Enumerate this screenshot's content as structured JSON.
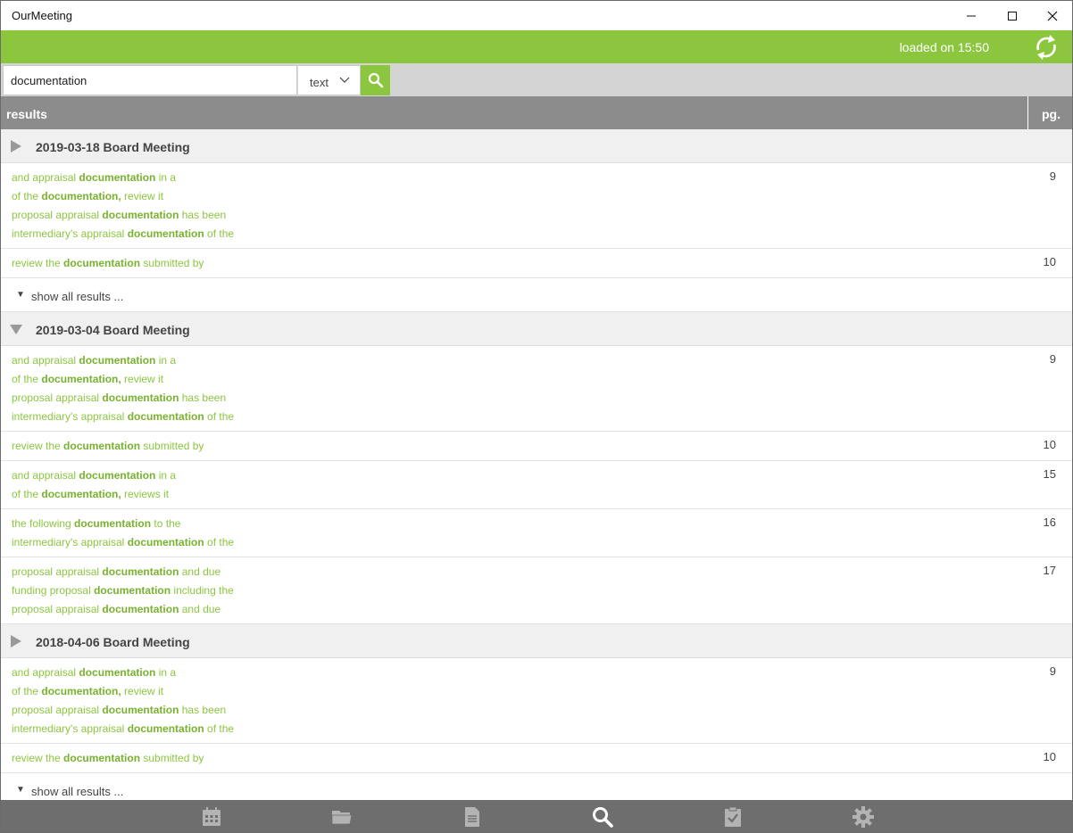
{
  "window": {
    "title": "OurMeeting"
  },
  "header": {
    "loaded_text": "loaded on 15:50"
  },
  "search": {
    "value": "documentation",
    "type_selected": "text"
  },
  "results_header": {
    "label": "results",
    "page_label": "pg."
  },
  "show_all_label": "show all results ...",
  "groups": [
    {
      "title": "2019-03-18 Board Meeting",
      "expanded": false,
      "hits": [
        {
          "page": "9",
          "lines": [
            {
              "pre": "and appraisal ",
              "term": "documentation",
              "post": " in a"
            },
            {
              "pre": "of the ",
              "term": "documentation,",
              "post": " review it"
            },
            {
              "pre": "proposal appraisal ",
              "term": "documentation",
              "post": " has been"
            },
            {
              "pre": "intermediary's appraisal ",
              "term": "documentation",
              "post": " of the"
            }
          ]
        },
        {
          "page": "10",
          "lines": [
            {
              "pre": "review the ",
              "term": "documentation",
              "post": " submitted by"
            }
          ]
        }
      ],
      "show_all": true
    },
    {
      "title": "2019-03-04 Board Meeting",
      "expanded": true,
      "hits": [
        {
          "page": "9",
          "lines": [
            {
              "pre": "and appraisal ",
              "term": "documentation",
              "post": " in a"
            },
            {
              "pre": "of the ",
              "term": "documentation,",
              "post": " review it"
            },
            {
              "pre": "proposal appraisal ",
              "term": "documentation",
              "post": " has been"
            },
            {
              "pre": "intermediary's appraisal ",
              "term": "documentation",
              "post": " of the"
            }
          ]
        },
        {
          "page": "10",
          "lines": [
            {
              "pre": "review the ",
              "term": "documentation",
              "post": " submitted by"
            }
          ]
        },
        {
          "page": "15",
          "lines": [
            {
              "pre": "and appraisal ",
              "term": "documentation",
              "post": " in a"
            },
            {
              "pre": "of the ",
              "term": "documentation,",
              "post": " reviews it"
            }
          ]
        },
        {
          "page": "16",
          "lines": [
            {
              "pre": "the following ",
              "term": "documentation",
              "post": " to the"
            },
            {
              "pre": "intermediary's appraisal ",
              "term": "documentation",
              "post": " of the"
            }
          ]
        },
        {
          "page": "17",
          "lines": [
            {
              "pre": "proposal appraisal ",
              "term": "documentation",
              "post": " and due"
            },
            {
              "pre": "funding proposal ",
              "term": "documentation",
              "post": " including the"
            },
            {
              "pre": "proposal appraisal ",
              "term": "documentation",
              "post": " and due"
            }
          ]
        }
      ],
      "show_all": false
    },
    {
      "title": "2018-04-06 Board Meeting",
      "expanded": false,
      "hits": [
        {
          "page": "9",
          "lines": [
            {
              "pre": "and appraisal ",
              "term": "documentation",
              "post": " in a"
            },
            {
              "pre": "of the ",
              "term": "documentation,",
              "post": " review it"
            },
            {
              "pre": "proposal appraisal ",
              "term": "documentation",
              "post": " has been"
            },
            {
              "pre": "intermediary's appraisal ",
              "term": "documentation",
              "post": " of the"
            }
          ]
        },
        {
          "page": "10",
          "lines": [
            {
              "pre": "review the ",
              "term": "documentation",
              "post": " submitted by"
            }
          ]
        }
      ],
      "show_all": true
    }
  ],
  "bottom_nav": [
    {
      "icon": "calendar-icon",
      "active": false
    },
    {
      "icon": "folder-icon",
      "active": false
    },
    {
      "icon": "document-icon",
      "active": false
    },
    {
      "icon": "search-icon",
      "active": true
    },
    {
      "icon": "clipboard-check-icon",
      "active": false
    },
    {
      "icon": "gear-icon",
      "active": false
    }
  ],
  "colors": {
    "accent": "#8cc63f",
    "header_gray": "#8c8c8c",
    "nav_bg": "#6e6e6e",
    "nav_icon": "#b3b3b3"
  }
}
